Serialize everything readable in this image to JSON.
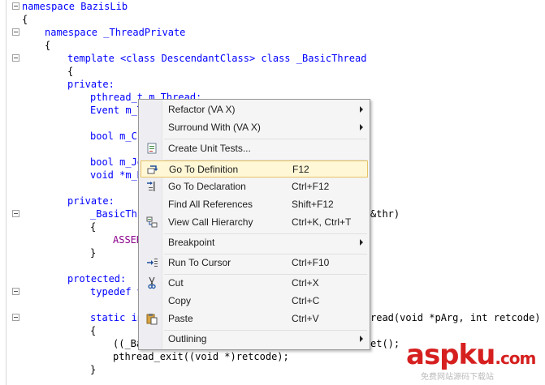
{
  "editor": {
    "lines": [
      {
        "text": "namespace BazisLib"
      },
      {
        "text": "{"
      },
      {
        "text": "namespace _ThreadPrivate"
      },
      {
        "text": "{"
      },
      {
        "text": "template <class DescendantClass> class _BasicThread"
      },
      {
        "text": "{"
      },
      {
        "text": "private:"
      },
      {
        "text": "pthread_t m_Thread;"
      },
      {
        "text": "Event m_T"
      },
      {
        "text": "bool m_Cr"
      },
      {
        "text": "bool m_Jo"
      },
      {
        "text": "void *m_R"
      },
      {
        "text": "private:"
      },
      {
        "text": "_BasicThr"
      },
      {
        "text": "&thr)"
      },
      {
        "text": "{"
      },
      {
        "text": "ASSER"
      },
      {
        "text": "}"
      },
      {
        "text": "protected:"
      },
      {
        "text": "typedef v"
      },
      {
        "text": "static in"
      },
      {
        "text": "read(void *pArg, int retcode)"
      },
      {
        "text": "{"
      },
      {
        "text": "((_Ba"
      },
      {
        "text": "et();"
      },
      {
        "text": "pthread_exit((void *)retcode);"
      },
      {
        "text": "}"
      }
    ]
  },
  "context_menu": {
    "items": [
      {
        "label": "Refactor (VA X)",
        "shortcut": "",
        "submenu": true,
        "icon": ""
      },
      {
        "label": "Surround With (VA X)",
        "shortcut": "",
        "submenu": true,
        "icon": ""
      },
      {
        "label": "Create Unit Tests...",
        "shortcut": "",
        "submenu": false,
        "icon": "unit-test-icon"
      },
      {
        "label": "Go To Definition",
        "shortcut": "F12",
        "submenu": false,
        "icon": "go-to-definition-icon",
        "highlighted": true
      },
      {
        "label": "Go To Declaration",
        "shortcut": "Ctrl+F12",
        "submenu": false,
        "icon": "go-to-declaration-icon"
      },
      {
        "label": "Find All References",
        "shortcut": "Shift+F12",
        "submenu": false,
        "icon": ""
      },
      {
        "label": "View Call Hierarchy",
        "shortcut": "Ctrl+K, Ctrl+T",
        "submenu": false,
        "icon": "call-hierarchy-icon"
      },
      {
        "label": "Breakpoint",
        "shortcut": "",
        "submenu": true,
        "icon": ""
      },
      {
        "label": "Run To Cursor",
        "shortcut": "Ctrl+F10",
        "submenu": false,
        "icon": "run-to-cursor-icon"
      },
      {
        "label": "Cut",
        "shortcut": "Ctrl+X",
        "submenu": false,
        "icon": "scissors-icon"
      },
      {
        "label": "Copy",
        "shortcut": "Ctrl+C",
        "submenu": false,
        "icon": "copy-icon"
      },
      {
        "label": "Paste",
        "shortcut": "Ctrl+V",
        "submenu": false,
        "icon": "paste-icon"
      },
      {
        "label": "Outlining",
        "shortcut": "",
        "submenu": true,
        "icon": ""
      }
    ]
  },
  "watermark": {
    "brand": "aspku",
    "tld": ".com",
    "subtitle": "免费网站源码下载站"
  },
  "colors": {
    "keyword": "#0000ff",
    "identifier": "#8b008b",
    "highlight_bg": "#fff7d6",
    "highlight_border": "#e5c365",
    "watermark": "#d61f1f"
  }
}
